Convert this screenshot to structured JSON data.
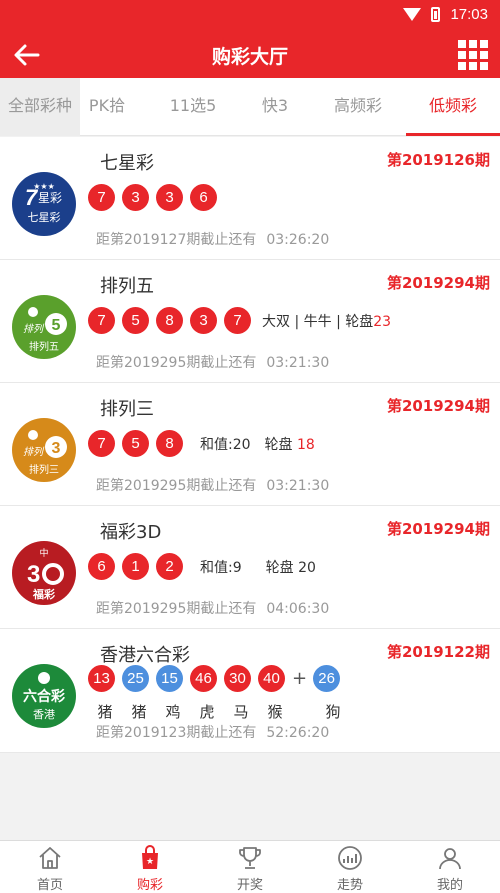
{
  "status_bar": {
    "time": "17:03",
    "icons": [
      "wifi-icon",
      "battery-icon"
    ]
  },
  "header": {
    "title": "购彩大厅",
    "back_icon": "arrow-left-icon",
    "menu_icon": "grid-icon"
  },
  "tabs": [
    {
      "label": "全部彩种"
    },
    {
      "label": "PK拾"
    },
    {
      "label": "11选5"
    },
    {
      "label": "快3"
    },
    {
      "label": "高频彩"
    },
    {
      "label": "低频彩",
      "active": true
    }
  ],
  "lotteries": [
    {
      "name": "七星彩",
      "period": "第2019126期",
      "balls": [
        "7",
        "3",
        "3",
        "6"
      ],
      "deadline_label": "距第2019127期截止还有",
      "countdown": "03:26:20",
      "logo_text": "七星彩",
      "logo_color": "#1b3f8b"
    },
    {
      "name": "排列五",
      "period": "第2019294期",
      "balls": [
        "7",
        "5",
        "8",
        "3",
        "7"
      ],
      "extra_text": "大双 | 牛牛 | 轮盘",
      "extra_num": "23",
      "deadline_label": "距第2019295期截止还有",
      "countdown": "03:21:30",
      "logo_text": "排列五",
      "logo_color": "#5aa02c"
    },
    {
      "name": "排列三",
      "period": "第2019294期",
      "balls": [
        "7",
        "5",
        "8"
      ],
      "sum_label": "和值:20",
      "roulette_label": "轮盘",
      "roulette_num": "18",
      "deadline_label": "距第2019295期截止还有",
      "countdown": "03:21:30",
      "logo_text": "排列三",
      "logo_color": "#d68a1a"
    },
    {
      "name": "福彩3D",
      "period": "第2019294期",
      "balls": [
        "6",
        "1",
        "2"
      ],
      "sum_label": "和值:9",
      "roulette_label": "轮盘 20",
      "deadline_label": "距第2019295期截止还有",
      "countdown": "04:06:30",
      "logo_text": "福彩",
      "logo_color": "#b81c22"
    },
    {
      "name": "香港六合彩",
      "period": "第2019122期",
      "balls": [
        {
          "n": "13",
          "color": "red"
        },
        {
          "n": "25",
          "color": "blue"
        },
        {
          "n": "15",
          "color": "blue"
        },
        {
          "n": "46",
          "color": "red"
        },
        {
          "n": "30",
          "color": "red"
        },
        {
          "n": "40",
          "color": "red"
        }
      ],
      "special": {
        "n": "26",
        "color": "blue"
      },
      "zodiacs": [
        "猪",
        "猪",
        "鸡",
        "虎",
        "马",
        "猴"
      ],
      "special_zodiac": "狗",
      "deadline_label": "距第2019123期截止还有",
      "countdown": "52:26:20",
      "logo_text": "六合彩",
      "logo_sub": "香港",
      "logo_color": "#1d8a3a"
    }
  ],
  "bottom_nav": [
    {
      "label": "首页",
      "icon": "home-icon"
    },
    {
      "label": "购彩",
      "icon": "shopping-bag-icon",
      "active": true
    },
    {
      "label": "开奖",
      "icon": "trophy-icon"
    },
    {
      "label": "走势",
      "icon": "trend-chart-icon"
    },
    {
      "label": "我的",
      "icon": "user-icon"
    }
  ],
  "colors": {
    "primary": "#e8262a",
    "ball_blue": "#4d8fde"
  }
}
